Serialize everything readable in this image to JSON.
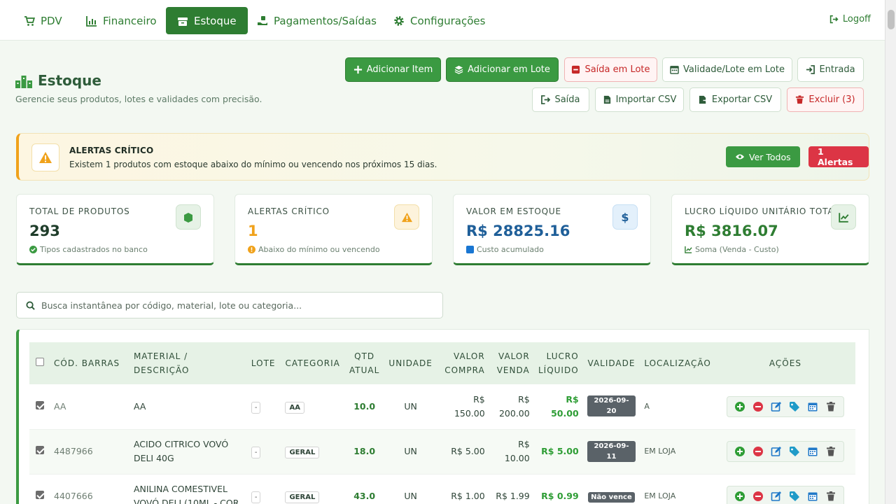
{
  "nav": {
    "items": [
      {
        "label": "PDV",
        "icon": "cart-icon",
        "active": false
      },
      {
        "label": "Financeiro",
        "icon": "chart-bar-icon",
        "active": false
      },
      {
        "label": "Estoque",
        "icon": "box-icon",
        "active": true
      },
      {
        "label": "Pagamentos/Saídas",
        "icon": "hand-money-icon",
        "active": false
      },
      {
        "label": "Configurações",
        "icon": "gear-icon",
        "active": false
      }
    ],
    "logoff": "Logoff"
  },
  "header": {
    "title": "Estoque",
    "subtitle": "Gerencie seus produtos, lotes e validades com precisão."
  },
  "toolbar": {
    "add_item": "Adicionar Item",
    "add_batch": "Adicionar em Lote",
    "batch_out": "Saída em Lote",
    "validity_batch": "Validade/Lote em Lote",
    "entry": "Entrada",
    "exit": "Saída",
    "import_csv": "Importar CSV",
    "export_csv": "Exportar CSV",
    "delete": "Excluir (3)"
  },
  "alert": {
    "title": "ALERTAS CRÍTICO",
    "text": "Existem 1 produtos com estoque abaixo do mínimo ou vencendo nos próximos 15 dias.",
    "view_all": "Ver Todos",
    "count": "1 Alertas",
    "accent": "#f0a21b"
  },
  "stats": [
    {
      "label": "TOTAL DE PRODUTOS",
      "value": "293",
      "note": "Tipos cadastrados no banco",
      "color": "#1f3d2a",
      "icon": "box-icon"
    },
    {
      "label": "ALERTAS CRÍTICO",
      "value": "1",
      "note": "Abaixo do mínimo ou vencendo",
      "color": "#f0a21b",
      "icon": "warning-icon"
    },
    {
      "label": "VALOR EM ESTOQUE",
      "value": "R$ 28825.16",
      "note": "Custo acumulado",
      "color": "#1f5f99",
      "icon": "dollar-icon"
    },
    {
      "label": "LUCRO LÍQUIDO UNITÁRIO TOTAL",
      "value": "R$ 3816.07",
      "note": "Soma (Venda - Custo)",
      "color": "#2e7d32",
      "icon": "trend-icon"
    }
  ],
  "search": {
    "placeholder": "Busca instantânea por código, material, lote ou categoria..."
  },
  "table": {
    "headers": {
      "barcode": "CÓD. BARRAS",
      "material": "MATERIAL / DESCRIÇÃO",
      "lote": "LOTE",
      "category": "CATEGORIA",
      "qty_1": "QTD",
      "qty_2": "ATUAL",
      "unit": "UNIDADE",
      "buy_1": "VALOR",
      "buy_2": "COMPRA",
      "sell_1": "VALOR",
      "sell_2": "VENDA",
      "profit_1": "LUCRO",
      "profit_2": "LÍQUIDO",
      "validity": "VALIDADE",
      "location": "LOCALIZAÇÃO",
      "actions": "AÇÕES"
    },
    "rows": [
      {
        "barcode": "AA",
        "material_1": "AA",
        "material_2": "",
        "lote": "-",
        "category": "AA",
        "qty": "10.0",
        "unit": "UN",
        "buy_1": "R$",
        "buy_2": "150.00",
        "sell_1": "R$",
        "sell_2": "200.00",
        "profit_1": "R$",
        "profit_2": "50.00",
        "validity": "2026-09-20",
        "location": "A"
      },
      {
        "barcode": "4487966",
        "material_1": "ACIDO CITRICO VOVÓ",
        "material_2": "DELI 40G",
        "lote": "-",
        "category": "GERAL",
        "qty": "18.0",
        "unit": "UN",
        "buy_1": "",
        "buy_2": "R$ 5.00",
        "sell_1": "R$",
        "sell_2": "10.00",
        "profit_1": "",
        "profit_2": "R$ 5.00",
        "validity": "2026-09-11",
        "location": "EM LOJA"
      },
      {
        "barcode": "4407666",
        "material_1": "ANILINA COMESTIVEL",
        "material_2": "VOVÓ DELI (10ML - COR",
        "lote": "-",
        "category": "GERAL",
        "qty": "43.0",
        "unit": "UN",
        "buy_1": "",
        "buy_2": "R$ 1.00",
        "sell_1": "",
        "sell_2": "R$ 1.99",
        "profit_1": "",
        "profit_2": "R$ 0.99",
        "validity": "Não vence",
        "location": "EM LOJA"
      }
    ]
  }
}
